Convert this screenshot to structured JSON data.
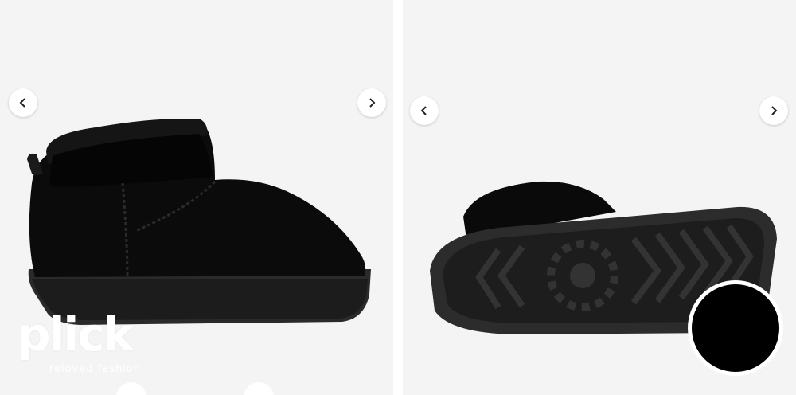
{
  "gallery": {
    "left_image": {
      "icon": "boot-side-view-image",
      "nav_prev": "chevron-left-icon",
      "nav_next": "chevron-right-icon"
    },
    "right_image": {
      "icon": "boot-sole-view-image",
      "nav_prev": "chevron-left-icon",
      "nav_next": "chevron-right-icon"
    }
  },
  "watermark": {
    "brand": "plick",
    "tagline": "reloved fashion"
  },
  "color_swatch": {
    "color": "#000000"
  }
}
